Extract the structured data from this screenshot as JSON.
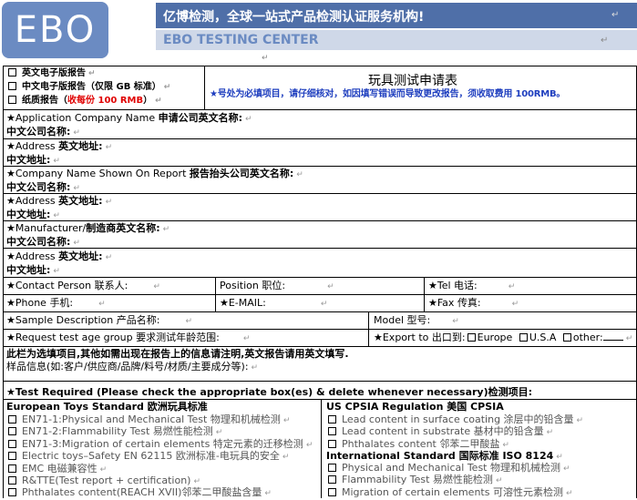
{
  "header": {
    "logo_text": "EBO",
    "slogan": "亿博检测，全球一站式产品检测认证服务机构!",
    "center_name": "EBO TESTING CENTER",
    "para_mark": "↵",
    "accent_blue": "#4f6fa8",
    "logo_bg": "#6b8bc2",
    "band_color": "#cfd8e8"
  },
  "report_options": [
    {
      "label": "英文电子版报告"
    },
    {
      "label": "中文电子版报告（仅限 GB 标准）"
    },
    {
      "label": "纸质报告（",
      "red": "收每份 100 RMB",
      "after": "）"
    }
  ],
  "form": {
    "title": "玩具测试申请表",
    "notice": "★号处为必填项目，请仔细核对，如因填写错误而导致更改报告，须收取费用 100RMB。",
    "sections": [
      {
        "en": "★Application Company Name",
        "cn": "申请公司英文名称:",
        "line2": "中文公司名称:"
      },
      {
        "en": "★Address",
        "cn": "英文地址:",
        "line2": "中文地址:"
      },
      {
        "en": "★Company Name Shown On Report",
        "cn": "报告抬头公司英文名称:",
        "line2": "中文公司名称:"
      },
      {
        "en": "★Address",
        "cn": "英文地址:",
        "line2": "中文地址:"
      },
      {
        "en": "★Manufacturer/",
        "cn": "制造商英文名称:",
        "line2": "中文公司名称:"
      },
      {
        "en": "★Address",
        "cn": "英文地址:",
        "line2": "中文地址:"
      }
    ],
    "contact": {
      "en": "★Contact Person",
      "cn": "联系人:"
    },
    "position": {
      "en": "Position",
      "cn": "职位:"
    },
    "tel": {
      "en": "★Tel",
      "cn": "电话:"
    },
    "phone": {
      "en": "★Phone",
      "cn": "手机:"
    },
    "email": {
      "label": "★E-MAIL:"
    },
    "fax": {
      "en": "★Fax",
      "cn": "传真:"
    },
    "sample_desc": {
      "en": "★Sample Description",
      "cn": "产品名称:"
    },
    "model": {
      "label": "Model 型号:"
    },
    "age_group": {
      "en": "★Request test age group",
      "cn": "要求测试年龄范围:"
    },
    "export": {
      "label": "★Export to 出口到:",
      "options": [
        "Europe",
        "U.S.A",
        "other:"
      ]
    },
    "info_note": "此栏为选填项目,其他如需出现在报告上的信息请注明,英文报告请用英文填写.",
    "info_sub": "样品信息(如:客户/供应商/品牌/料号/材质/主要成分等):",
    "test_required": "★Test Required (Please check the appropriate box(es) & delete whenever necessary)检测项目:"
  },
  "tests": {
    "eu_header": "European Toys Standard  欧洲玩具标准",
    "eu_items": [
      "EN71-1:Physical and Mechanical Test 物理和机械检测",
      "EN71-2:Flammability Test 易燃性能检测",
      "EN71-3:Migration of certain elements 特定元素的迁移检测",
      "Electric toys–Safety EN 62115 欧洲标准-电玩具的安全",
      "EMC 电磁兼容性",
      "R&TTE(Test report + certification)",
      "Phthalates content(REACH XVII)邻苯二甲酸盐含量"
    ],
    "us_header": "US CPSIA Regulation  美国 CPSIA",
    "us_items": [
      "Lead content in surface coating 涂层中的铅含量",
      "Lead content in substrate 基材中的铅含量",
      "Phthalates content 邻苯二甲酸盐"
    ],
    "intl_header": "International Standard 国际标准 ISO 8124",
    "intl_items": [
      "Physical and Mechanical Test 物理和机械检测",
      "Flammability Test 易燃性能检测",
      "Migration of certain elements 可溶性元素检测"
    ]
  }
}
